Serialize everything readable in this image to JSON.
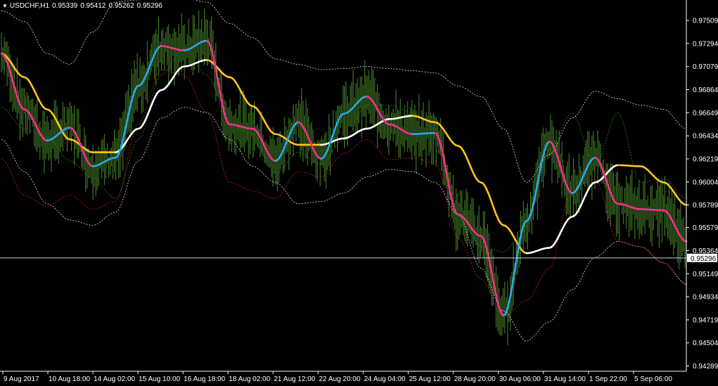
{
  "header": {
    "symbol": "USDCHF,H1",
    "open": "0.95339",
    "high": "0.95412",
    "low": "0.95262",
    "close": "0.95296"
  },
  "colors": {
    "background": "#000000",
    "axis": "#ffffff",
    "bars": "#4a8a2a",
    "fast_ma_up": "#29a9e8",
    "fast_ma_down": "#ff2a8e",
    "slow_ma_up": "#ffffff",
    "slow_ma_down": "#ffc61a",
    "inner_band": "#2a8a1a",
    "inner_band_lower": "#cc2222",
    "outer_band": "#e8e8c8",
    "price_line": "#c8d0dc"
  },
  "chart_data": {
    "type": "line",
    "title": "USDCHF,H1",
    "current_price": 0.95296,
    "ylim": [
      0.9424,
      0.9766
    ],
    "y_ticks": [
      "0.97509",
      "0.97294",
      "0.97079",
      "0.96864",
      "0.96649",
      "0.96434",
      "0.96219",
      "0.96004",
      "0.95789",
      "0.95579",
      "0.95364",
      "0.95149",
      "0.94934",
      "0.94719",
      "0.94504",
      "0.94289"
    ],
    "x_labels": [
      "9 Aug 2017",
      "10 Aug 18:00",
      "14 Aug 02:00",
      "15 Aug 10:00",
      "16 Aug 18:00",
      "18 Aug 02:00",
      "21 Aug 12:00",
      "22 Aug 20:00",
      "24 Aug 04:00",
      "25 Aug 12:00",
      "28 Aug 20:00",
      "30 Aug 06:00",
      "31 Aug 14:00",
      "1 Sep 22:00",
      "5 Sep 06:00"
    ],
    "x": [
      0,
      12,
      24,
      36,
      48,
      60,
      72,
      84,
      96,
      108,
      120,
      132,
      144,
      156,
      168,
      180,
      192,
      204,
      216,
      228,
      240,
      252,
      264,
      276,
      288,
      300,
      312,
      324,
      336,
      348,
      360
    ],
    "series": [
      {
        "values": [
          0.972,
          0.9668,
          0.9639,
          0.9651,
          0.9615,
          0.9623,
          0.969,
          0.9727,
          0.9723,
          0.9732,
          0.9654,
          0.965,
          0.962,
          0.9656,
          0.9622,
          0.9664,
          0.968,
          0.9654,
          0.9645,
          0.9646,
          0.957,
          0.955,
          0.9476,
          0.9564,
          0.9638,
          0.959,
          0.9623,
          0.958,
          0.9575,
          0.9574,
          0.9545
        ]
      },
      {
        "values": [
          0.972,
          0.9698,
          0.9668,
          0.964,
          0.9628,
          0.9628,
          0.965,
          0.9686,
          0.9708,
          0.9714,
          0.9698,
          0.9671,
          0.9645,
          0.9635,
          0.9635,
          0.9641,
          0.965,
          0.9659,
          0.9662,
          0.9656,
          0.9634,
          0.96,
          0.956,
          0.9534,
          0.9539,
          0.9568,
          0.96,
          0.9616,
          0.9615,
          0.96,
          0.9579
        ]
      },
      {
        "values": [
          0.967,
          0.965,
          0.9642,
          0.962,
          0.9604,
          0.9585,
          0.964,
          0.97,
          0.9725,
          0.97,
          0.9655,
          0.9645,
          0.9608,
          0.9628,
          0.9617,
          0.964,
          0.9672,
          0.9672,
          0.9665,
          0.965,
          0.958,
          0.954,
          0.9535,
          0.956,
          0.963,
          0.9665,
          0.9615,
          0.9665,
          0.96,
          0.9604,
          0.9585
        ]
      },
      {
        "values": [
          0.9622,
          0.9588,
          0.9578,
          0.9588,
          0.9575,
          0.9582,
          0.9655,
          0.9705,
          0.97,
          0.9665,
          0.96,
          0.9592,
          0.9585,
          0.961,
          0.9605,
          0.9627,
          0.964,
          0.9621,
          0.9623,
          0.9618,
          0.9548,
          0.951,
          0.9475,
          0.949,
          0.952,
          0.9595,
          0.9603,
          0.9545,
          0.954,
          0.9525,
          0.9506
        ]
      },
      {
        "values": [
          0.976,
          0.975,
          0.972,
          0.971,
          0.974,
          0.9768,
          0.977,
          0.9775,
          0.9772,
          0.9768,
          0.9748,
          0.9735,
          0.9715,
          0.971,
          0.9705,
          0.9706,
          0.9708,
          0.9706,
          0.9704,
          0.9702,
          0.969,
          0.968,
          0.965,
          0.96,
          0.9626,
          0.966,
          0.9685,
          0.9678,
          0.9672,
          0.9668,
          0.965
        ]
      },
      {
        "values": [
          0.964,
          0.961,
          0.958,
          0.9565,
          0.956,
          0.9572,
          0.962,
          0.966,
          0.967,
          0.9665,
          0.964,
          0.9615,
          0.96,
          0.958,
          0.9582,
          0.959,
          0.9605,
          0.9612,
          0.961,
          0.96,
          0.957,
          0.952,
          0.948,
          0.9452,
          0.947,
          0.95,
          0.953,
          0.9545,
          0.954,
          0.9525,
          0.9505
        ]
      }
    ]
  }
}
